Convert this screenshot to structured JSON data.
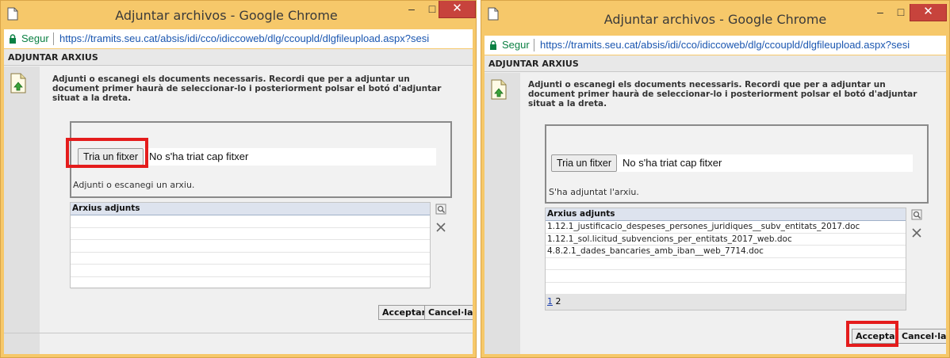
{
  "left": {
    "title": "Adjuntar archivos - Google Chrome",
    "window_buttons": {
      "minimize": "–",
      "maximize": "□",
      "close": "✕"
    },
    "address": {
      "secure": "Segur",
      "url": "https://tramits.seu.cat/absis/idi/cco/idiccoweb/dlg/ccoupld/dlgfileupload.aspx?sesi"
    },
    "header": "ADJUNTAR ARXIUS",
    "message": [
      "Adjunti o escanegi els documents necessaris. Recordi que per a adjuntar un",
      "document primer haurà de seleccionar-lo i posteriorment polsar el botó d'adjuntar",
      "situat a la dreta."
    ],
    "file_button": "Tria un fitxer",
    "no_file": "No s'ha triat cap fitxer",
    "status": "Adjunti o escanegi un arxiu.",
    "grid_header": "Arxius adjunts",
    "rows": [],
    "accept": "Acceptar",
    "cancel": "Cancel·lar"
  },
  "right": {
    "title": "Adjuntar archivos - Google Chrome",
    "window_buttons": {
      "minimize": "–",
      "maximize": "□",
      "close": "✕"
    },
    "address": {
      "secure": "Segur",
      "url": "https://tramits.seu.cat/absis/idi/cco/idiccoweb/dlg/ccoupld/dlgfileupload.aspx?sesi"
    },
    "header": "ADJUNTAR ARXIUS",
    "message": [
      "Adjunti o escanegi els documents necessaris. Recordi que per a adjuntar un",
      "document primer haurà de seleccionar-lo i posteriorment polsar el botó d'adjuntar",
      "situat a la dreta."
    ],
    "file_button": "Tria un fitxer",
    "no_file": "No s'ha triat cap fitxer",
    "status": "S'ha adjuntat l'arxiu.",
    "grid_header": "Arxius adjunts",
    "rows": [
      "1.12.1_justificacio_despeses_persones_juridiques__subv_entitats_2017.doc",
      "1.12.1_sol.licitud_subvencions_per_entitats_2017_web.doc",
      "4.8.2.1_dades_bancaries_amb_iban__web_7714.doc"
    ],
    "pager": {
      "page1": "1",
      "page2": "2"
    },
    "accept": "Acceptar",
    "cancel": "Cancel·lar"
  },
  "colors": {
    "highlight": "#e41c1c",
    "frame": "#f6c86a",
    "close": "#c7433c"
  }
}
